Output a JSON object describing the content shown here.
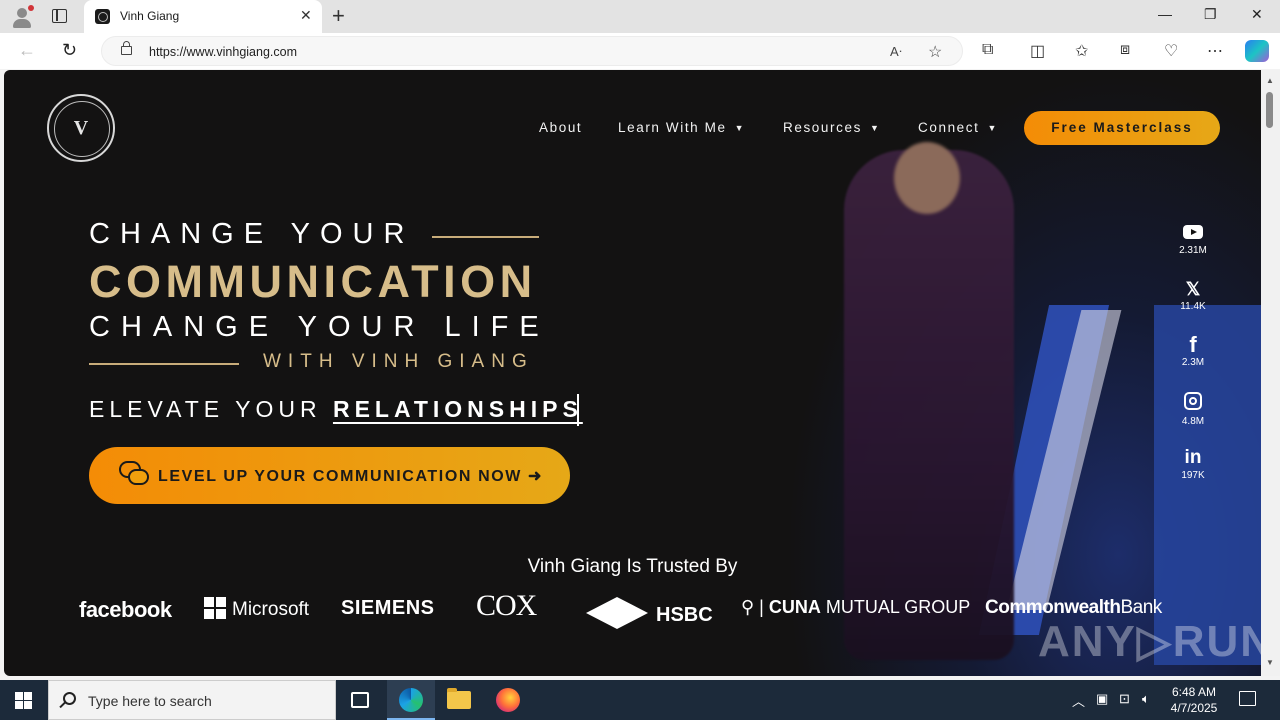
{
  "browser": {
    "tab_title": "Vinh Giang",
    "url": "https://www.vinhgiang.com",
    "new_tab_label": "+",
    "close_tab_label": "✕",
    "minimize": "—",
    "restore": "❐",
    "close": "✕"
  },
  "site": {
    "logo_mark": "V",
    "nav": {
      "about": "About",
      "learn": "Learn With Me",
      "resources": "Resources",
      "connect": "Connect",
      "caret": "▼"
    },
    "cta_top": "Free Masterclass",
    "hero": {
      "line1": "CHANGE YOUR",
      "line2": "COMMUNICATION",
      "line3": "CHANGE YOUR LIFE",
      "line4": "WITH VINH GIANG",
      "elevate_prefix": "ELEVATE YOUR ",
      "elevate_typed": "RELATIONSHIPS",
      "cta_main": "LEVEL UP YOUR COMMUNICATION NOW ➜"
    },
    "social": [
      {
        "icon": "youtube-icon",
        "glyph": "",
        "count": "2.31M"
      },
      {
        "icon": "x-icon",
        "glyph": "𝕏",
        "count": "11.4K"
      },
      {
        "icon": "facebook-icon",
        "glyph": "f",
        "count": "2.3M"
      },
      {
        "icon": "instagram-icon",
        "glyph": "",
        "count": "4.8M"
      },
      {
        "icon": "linkedin-icon",
        "glyph": "in",
        "count": "197K"
      }
    ],
    "trusted_heading": "Vinh Giang Is Trusted By",
    "brands": {
      "facebook": "facebook",
      "microsoft": "Microsoft",
      "siemens": "SIEMENS",
      "cox": "COX",
      "hsbc": "HSBC",
      "cuna_a": "CUNA",
      "cuna_b": " MUTUAL GROUP",
      "cba_a": "Commonwealth",
      "cba_b": "Bank"
    },
    "watermark": "ANY▷RUN"
  },
  "taskbar": {
    "search_placeholder": "Type here to search",
    "time": "6:48 AM",
    "date": "4/7/2025"
  },
  "colors": {
    "page_bg": "#131212",
    "gold": "#d7bd8a",
    "cta_orange": "#f48c06",
    "taskbar": "#1c2a3a"
  }
}
